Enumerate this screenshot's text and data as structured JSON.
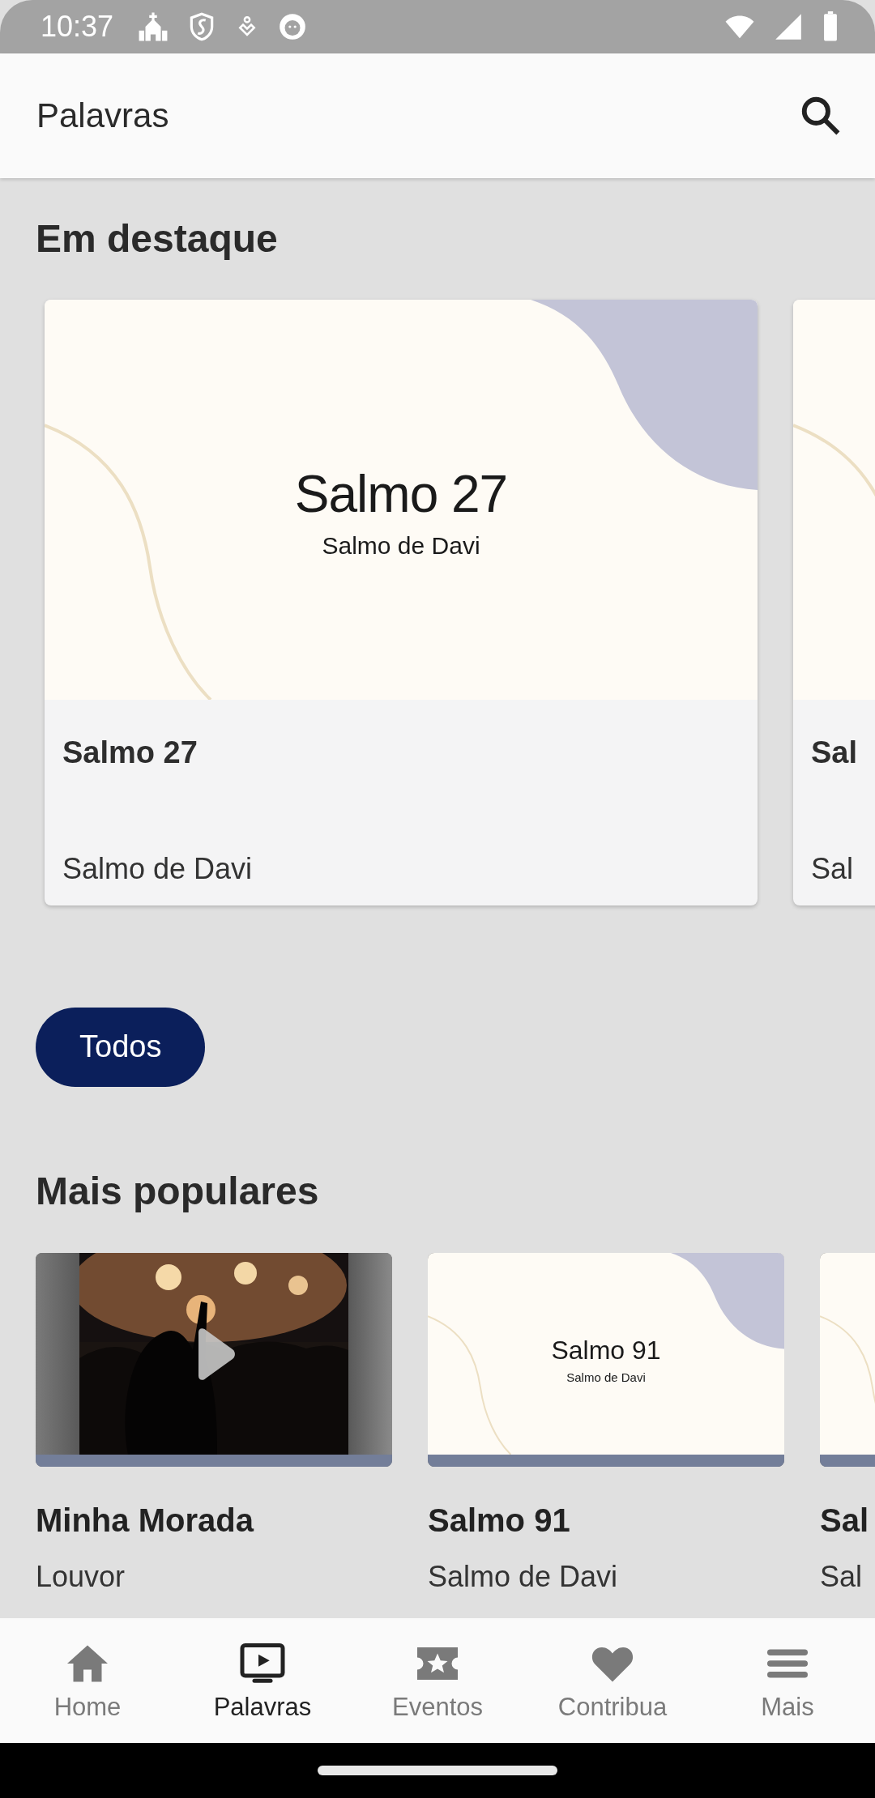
{
  "status_bar": {
    "time": "10:37"
  },
  "app_bar": {
    "title": "Palavras"
  },
  "featured": {
    "heading": "Em destaque",
    "cards": [
      {
        "thumb_title": "Salmo 27",
        "thumb_subtitle": "Salmo de Davi",
        "title": "Salmo 27",
        "subtitle": "Salmo de Davi"
      },
      {
        "title": "Sal",
        "subtitle": "Sal"
      }
    ]
  },
  "filters": [
    {
      "label": "Todos",
      "selected": true
    }
  ],
  "popular": {
    "heading": "Mais populares",
    "cards": [
      {
        "kind": "video",
        "title": "Minha Morada",
        "subtitle": "Louvor"
      },
      {
        "kind": "slide",
        "thumb_title": "Salmo 91",
        "thumb_subtitle": "Salmo de Davi",
        "title": "Salmo 91",
        "subtitle": "Salmo de Davi"
      },
      {
        "kind": "slide",
        "title": "Sal",
        "subtitle": "Sal"
      }
    ]
  },
  "bottom_nav": [
    {
      "kind": "home",
      "label": "Home",
      "selected": false
    },
    {
      "kind": "tv",
      "label": "Palavras",
      "selected": true
    },
    {
      "kind": "ticket",
      "label": "Eventos",
      "selected": false
    },
    {
      "kind": "heart",
      "label": "Contribua",
      "selected": false
    },
    {
      "kind": "menu",
      "label": "Mais",
      "selected": false
    }
  ]
}
